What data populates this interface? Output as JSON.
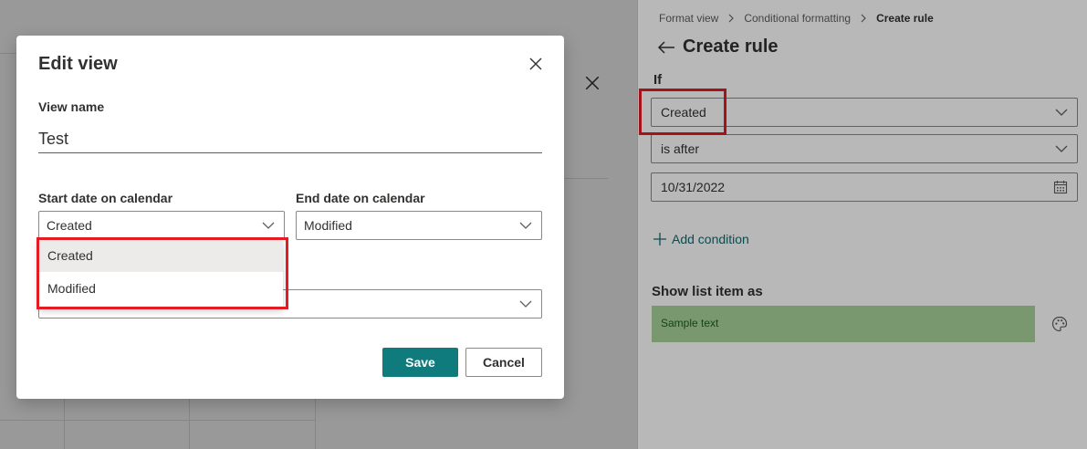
{
  "dialog": {
    "title": "Edit view",
    "view_name_label": "View name",
    "view_name_value": "Test",
    "start_date_label": "Start date on calendar",
    "start_date_value": "Created",
    "end_date_label": "End date on calendar",
    "end_date_value": "Modified",
    "start_date_options": [
      "Created",
      "Modified"
    ],
    "save_label": "Save",
    "cancel_label": "Cancel"
  },
  "rule_panel": {
    "breadcrumb": [
      "Format view",
      "Conditional formatting",
      "Create rule"
    ],
    "title": "Create rule",
    "if_label": "If",
    "condition_field": "Created",
    "condition_operator": "is after",
    "condition_value": "10/31/2022",
    "add_condition_label": "Add condition",
    "show_as_label": "Show list item as",
    "sample_text": "Sample text"
  },
  "icons": [
    "close-icon",
    "chevron-down-icon",
    "back-arrow-icon",
    "calendar-icon",
    "plus-icon",
    "palette-icon",
    "chevron-right-icon"
  ],
  "colors": {
    "accent": "#0f7b7d",
    "highlight": "#e41b23",
    "sample_fill": "#a9d39a"
  }
}
